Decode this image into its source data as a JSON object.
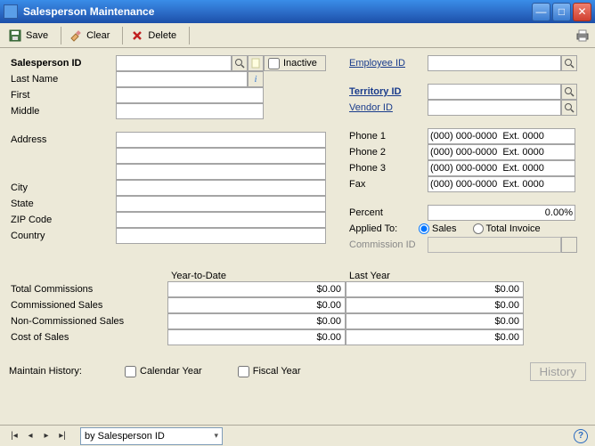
{
  "window": {
    "title": "Salesperson Maintenance"
  },
  "toolbar": {
    "save": "Save",
    "clear": "Clear",
    "delete": "Delete"
  },
  "labels": {
    "salesperson_id": "Salesperson ID",
    "inactive": "Inactive",
    "last_name": "Last Name",
    "first": "First",
    "middle": "Middle",
    "address": "Address",
    "city": "City",
    "state": "State",
    "zip": "ZIP Code",
    "country": "Country",
    "employee_id": "Employee ID",
    "territory_id": "Territory ID",
    "vendor_id": "Vendor ID",
    "phone1": "Phone 1",
    "phone2": "Phone 2",
    "phone3": "Phone 3",
    "fax": "Fax",
    "percent": "Percent",
    "applied_to": "Applied To:",
    "sales": "Sales",
    "total_invoice": "Total Invoice",
    "commission_id": "Commission ID",
    "ytd": "Year-to-Date",
    "last_year": "Last Year",
    "total_commissions": "Total Commissions",
    "commissioned_sales": "Commissioned Sales",
    "non_commissioned_sales": "Non-Commissioned Sales",
    "cost_of_sales": "Cost of Sales",
    "maintain_history": "Maintain History:",
    "calendar_year": "Calendar Year",
    "fiscal_year": "Fiscal Year",
    "history_btn": "History",
    "sort_by": "by Salesperson ID"
  },
  "values": {
    "salesperson_id": "",
    "last_name": "",
    "first": "",
    "middle": "",
    "address1": "",
    "address2": "",
    "address3": "",
    "city": "",
    "state": "",
    "zip": "",
    "country": "",
    "employee_id": "",
    "territory_id": "",
    "vendor_id": "",
    "phone1": "(000) 000-0000  Ext. 0000",
    "phone2": "(000) 000-0000  Ext. 0000",
    "phone3": "(000) 000-0000  Ext. 0000",
    "fax": "(000) 000-0000  Ext. 0000",
    "percent": "0.00%",
    "commission_id": "",
    "totals": {
      "total_commissions": {
        "ytd": "$0.00",
        "ly": "$0.00"
      },
      "commissioned_sales": {
        "ytd": "$0.00",
        "ly": "$0.00"
      },
      "non_commissioned_sales": {
        "ytd": "$0.00",
        "ly": "$0.00"
      },
      "cost_of_sales": {
        "ytd": "$0.00",
        "ly": "$0.00"
      }
    },
    "applied_to": "Sales",
    "inactive": false,
    "calendar_year": false,
    "fiscal_year": false
  }
}
